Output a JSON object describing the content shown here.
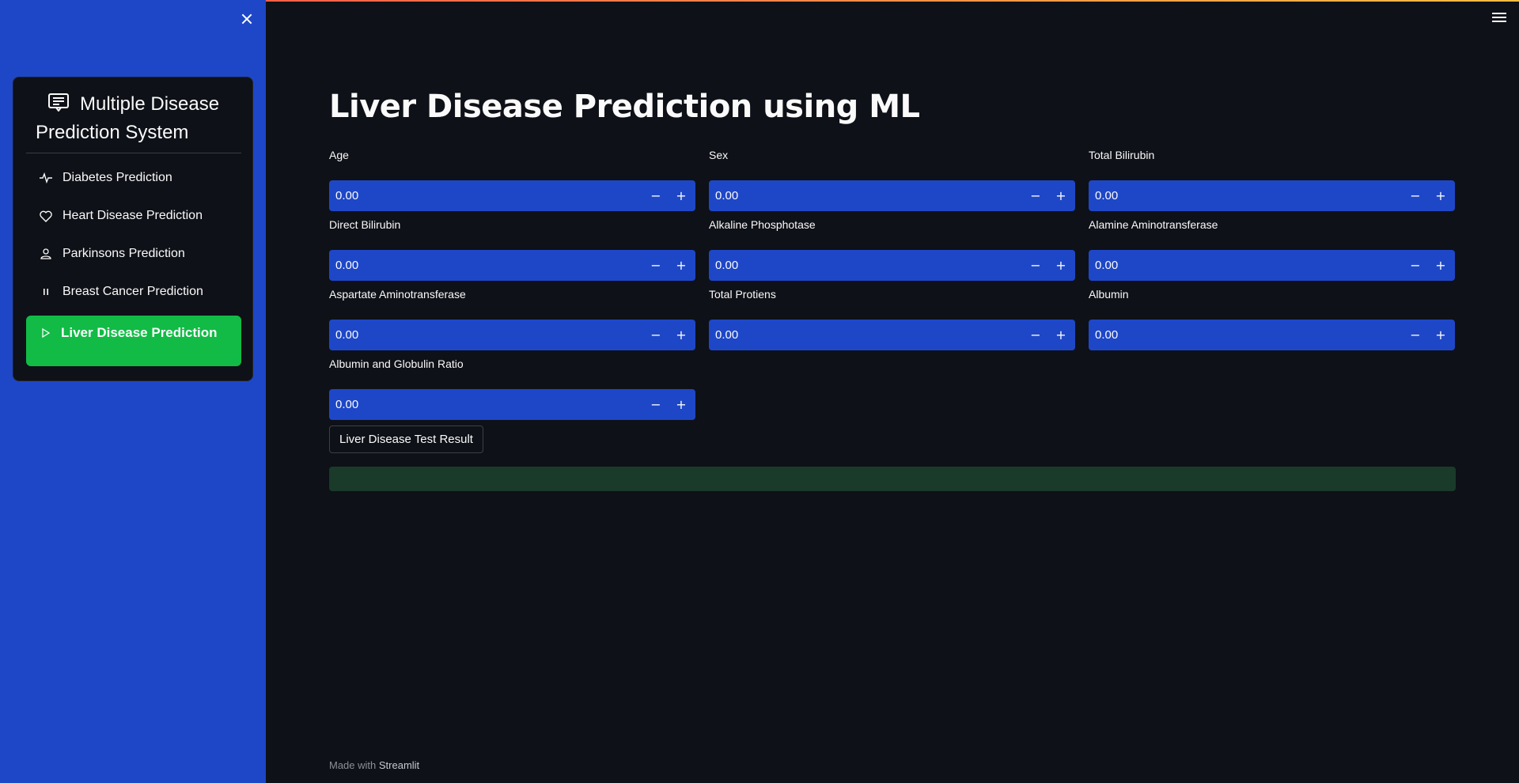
{
  "sidebar": {
    "menu_title": "Multiple Disease Prediction System",
    "menu_title_icon": "document-list-icon",
    "items": [
      {
        "label": "Diabetes Prediction",
        "icon": "activity-icon"
      },
      {
        "label": "Heart Disease Prediction",
        "icon": "heart-icon"
      },
      {
        "label": "Parkinsons Prediction",
        "icon": "person-icon"
      },
      {
        "label": "Breast Cancer Prediction",
        "icon": "pause-icon"
      },
      {
        "label": "Liver Disease Prediction",
        "icon": "play-icon",
        "active": true
      }
    ],
    "background_color": "#1e47c8",
    "active_color": "#11bb46"
  },
  "main": {
    "title": "Liver Disease Prediction using ML",
    "fields": [
      {
        "label": "Age",
        "value": "0.00"
      },
      {
        "label": "Sex",
        "value": "0.00"
      },
      {
        "label": "Total Bilirubin",
        "value": "0.00"
      },
      {
        "label": "Direct Bilirubin",
        "value": "0.00"
      },
      {
        "label": "Alkaline Phosphotase",
        "value": "0.00"
      },
      {
        "label": "Alamine Aminotransferase",
        "value": "0.00"
      },
      {
        "label": "Aspartate Aminotransferase",
        "value": "0.00"
      },
      {
        "label": "Total Protiens",
        "value": "0.00"
      },
      {
        "label": "Albumin",
        "value": "0.00"
      },
      {
        "label": "Albumin and Globulin Ratio",
        "value": "0.00"
      }
    ],
    "stepper_minus": "−",
    "stepper_plus": "+",
    "submit_label": "Liver Disease Test Result",
    "result_text": ""
  },
  "footer": {
    "prefix": "Made with ",
    "brand": "Streamlit"
  }
}
